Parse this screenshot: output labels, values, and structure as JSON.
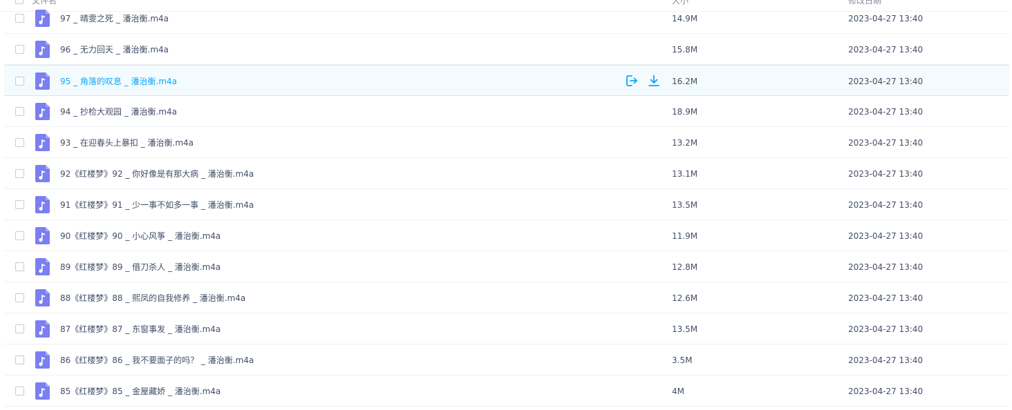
{
  "header": {
    "name_label": "文件名",
    "size_label": "大小",
    "date_label": "修改日期"
  },
  "colors": {
    "file_icon": "#7b7ff1",
    "accent": "#06a7ff",
    "hover_bg": "#f4fbfe"
  },
  "files": [
    {
      "name": "97 _ 晴雯之死 _ 潘治衡.m4a",
      "size": "14.9M",
      "date": "2023-04-27 13:40",
      "icon": "music-file-icon"
    },
    {
      "name": "96 _ 无力回天 _ 潘治衡.m4a",
      "size": "15.8M",
      "date": "2023-04-27 13:40",
      "icon": "music-file-icon"
    },
    {
      "name": "95 _ 角落的叹息 _ 潘治衡.m4a",
      "size": "16.2M",
      "date": "2023-04-27 13:40",
      "icon": "music-file-icon",
      "hovered": true
    },
    {
      "name": "94 _ 抄检大观园 _ 潘治衡.m4a",
      "size": "18.9M",
      "date": "2023-04-27 13:40",
      "icon": "music-file-icon"
    },
    {
      "name": "93 _ 在迎春头上暴扣 _ 潘治衡.m4a",
      "size": "13.2M",
      "date": "2023-04-27 13:40",
      "icon": "music-file-icon"
    },
    {
      "name": "92《红楼梦》92 _ 你好像是有那大病 _ 潘治衡.m4a",
      "size": "13.1M",
      "date": "2023-04-27 13:40",
      "icon": "music-file-icon"
    },
    {
      "name": "91《红楼梦》91 _ 少一事不如多一事 _ 潘治衡.m4a",
      "size": "13.5M",
      "date": "2023-04-27 13:40",
      "icon": "music-file-icon"
    },
    {
      "name": "90《红楼梦》90 _ 小心风筝 _ 潘治衡.m4a",
      "size": "11.9M",
      "date": "2023-04-27 13:40",
      "icon": "music-file-icon"
    },
    {
      "name": "89《红楼梦》89 _ 借刀杀人 _ 潘治衡.m4a",
      "size": "12.8M",
      "date": "2023-04-27 13:40",
      "icon": "music-file-icon"
    },
    {
      "name": "88《红楼梦》88 _ 熙凤的自我修养 _ 潘治衡.m4a",
      "size": "12.6M",
      "date": "2023-04-27 13:40",
      "icon": "music-file-icon"
    },
    {
      "name": "87《红楼梦》87 _ 东窗事发 _ 潘治衡.m4a",
      "size": "13.5M",
      "date": "2023-04-27 13:40",
      "icon": "music-file-icon"
    },
    {
      "name": "86《红楼梦》86 _ 我不要面子的吗？ _ 潘治衡.m4a",
      "size": "3.5M",
      "date": "2023-04-27 13:40",
      "icon": "music-file-icon"
    },
    {
      "name": "85《红楼梦》85 _ 金屋藏娇 _ 潘治衡.m4a",
      "size": "4M",
      "date": "2023-04-27 13:40",
      "icon": "music-file-icon"
    }
  ],
  "hover_actions": [
    {
      "icon": "share-icon",
      "label": "分享"
    },
    {
      "icon": "download-icon",
      "label": "下载"
    }
  ]
}
